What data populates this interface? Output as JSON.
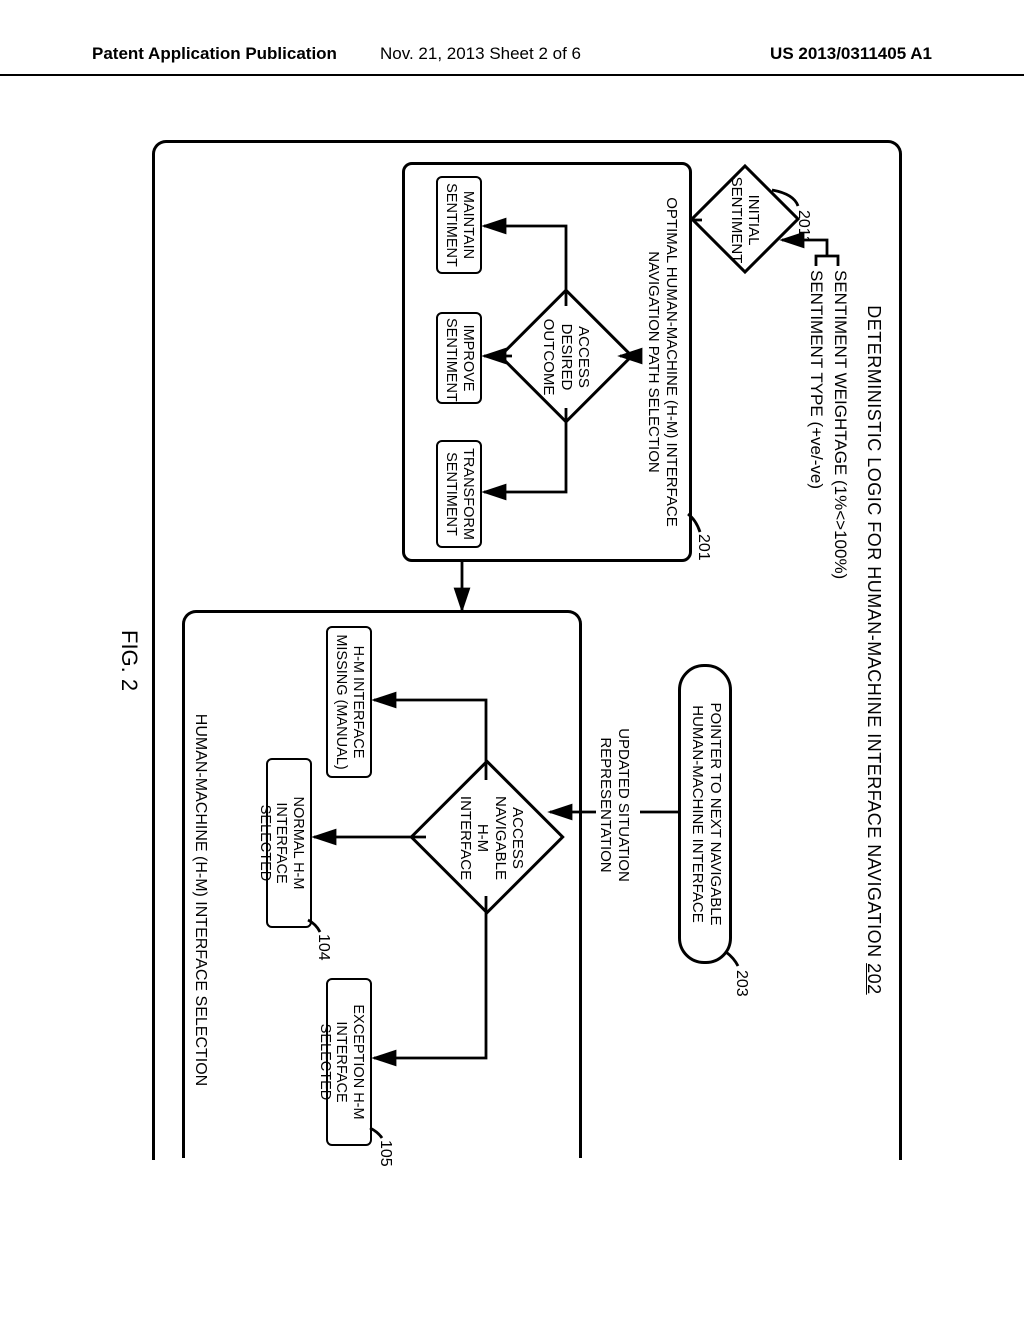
{
  "header": {
    "left": "Patent Application Publication",
    "center": "Nov. 21, 2013  Sheet 2 of 6",
    "right": "US 2013/0311405 A1"
  },
  "diagram": {
    "title_prefix": "DETERMINISTIC LOGIC FOR HUMAN-MACHINE INTERFACE NAVIGATION ",
    "title_ref": "202",
    "sentiment_weightage": "SENTIMENT WEIGHTAGE (1%<>100%)",
    "sentiment_type": "SENTIMENT TYPE (+ve/-ve)",
    "initial_sentiment": "INITIAL\nSENTIMENT",
    "ref_2011": "2011",
    "box201_title": "OPTIMAL HUMAN-MACHINE (H-M) INTERFACE\nNAVIGATION PATH SELECTION",
    "ref_201": "201",
    "access_desired_outcome": "ACCESS\nDESIRED\nOUTCOME",
    "maintain": "MAINTAIN\nSENTIMENT",
    "improve": "IMPROVE\nSENTIMENT",
    "transform": "TRANSFORM\nSENTIMENT",
    "pointer_box": "POINTER TO NEXT NAVIGABLE\nHUMAN-MACHINE INTERFACE",
    "ref_203": "203",
    "updated_situation": "UPDATED SITUATION\nREPRESENTATION",
    "access_navigable": "ACCESS\nNAVIGABLE\nH-M\nINTERFACE",
    "hm_missing": "H-M INTERFACE\nMISSING (MANUAL)",
    "normal_hm": "NORMAL H-M\nINTERFACE SELECTED",
    "ref_104": "104",
    "exception_hm": "EXCEPTION H-M\nINTERFACE SELECTED",
    "ref_105": "105",
    "selection_title": "HUMAN-MACHINE (H-M) INTERFACE SELECTION"
  },
  "figure_label": "FIG. 2"
}
